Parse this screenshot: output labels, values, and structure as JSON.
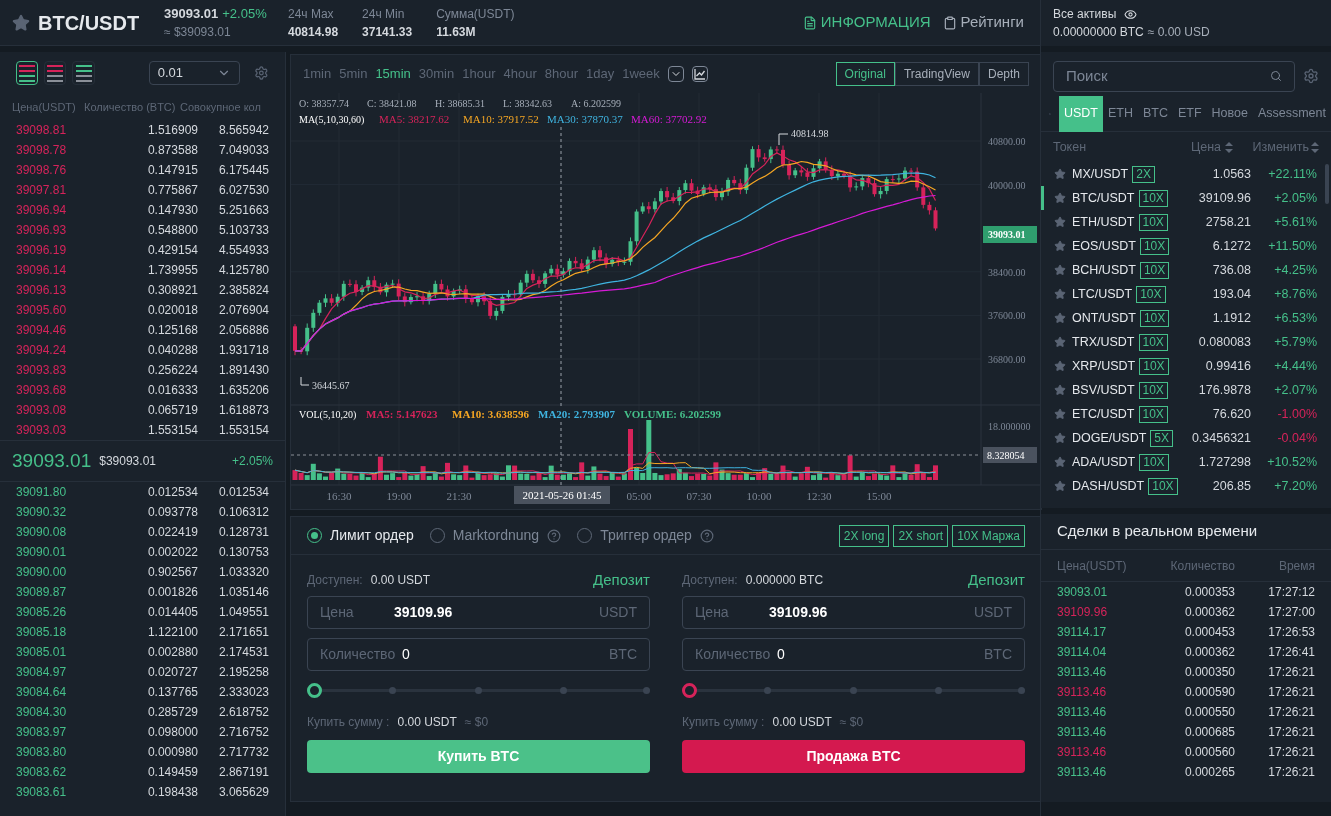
{
  "header": {
    "pair": "BTC/USDT",
    "price": "39093.01",
    "change": "+2.05%",
    "price_usd": "≈ $39093.01",
    "stats": [
      {
        "label": "24ч Max",
        "value": "40814.98"
      },
      {
        "label": "24ч Min",
        "value": "37141.33"
      },
      {
        "label": "Сумма(USDT)",
        "value": "11.63M"
      }
    ],
    "links": [
      {
        "kind": "info",
        "label": "ИНФОРМАЦИЯ"
      },
      {
        "kind": "ratings",
        "label": "Рейтинги"
      }
    ]
  },
  "order_book": {
    "views": [
      {
        "kind": "both",
        "selected": true
      },
      {
        "kind": "asks",
        "selected": false
      },
      {
        "kind": "bids",
        "selected": false
      }
    ],
    "precision": "0.01",
    "columns": [
      "Цена(USDT)",
      "Количество (BTC)",
      "Совокупное кол"
    ],
    "asks": [
      [
        "39098.81",
        "1.516909",
        "8.565942"
      ],
      [
        "39098.78",
        "0.873588",
        "7.049033"
      ],
      [
        "39098.76",
        "0.147915",
        "6.175445"
      ],
      [
        "39097.81",
        "0.775867",
        "6.027530"
      ],
      [
        "39096.94",
        "0.147930",
        "5.251663"
      ],
      [
        "39096.93",
        "0.548800",
        "5.103733"
      ],
      [
        "39096.19",
        "0.429154",
        "4.554933"
      ],
      [
        "39096.14",
        "1.739955",
        "4.125780"
      ],
      [
        "39096.13",
        "0.308921",
        "2.385824"
      ],
      [
        "39095.60",
        "0.020018",
        "2.076904"
      ],
      [
        "39094.46",
        "0.125168",
        "2.056886"
      ],
      [
        "39094.24",
        "0.040288",
        "1.931718"
      ],
      [
        "39093.83",
        "0.256224",
        "1.891430"
      ],
      [
        "39093.68",
        "0.016333",
        "1.635206"
      ],
      [
        "39093.08",
        "0.065719",
        "1.618873"
      ],
      [
        "39093.03",
        "1.553154",
        "1.553154"
      ]
    ],
    "last_price": "39093.01",
    "last_price_usd": "$39093.01",
    "last_change": "+2.05%",
    "bids": [
      [
        "39091.80",
        "0.012534",
        "0.012534"
      ],
      [
        "39090.32",
        "0.093778",
        "0.106312"
      ],
      [
        "39090.08",
        "0.022419",
        "0.128731"
      ],
      [
        "39090.01",
        "0.002022",
        "0.130753"
      ],
      [
        "39090.00",
        "0.902567",
        "1.033320"
      ],
      [
        "39089.87",
        "0.001826",
        "1.035146"
      ],
      [
        "39085.26",
        "0.014405",
        "1.049551"
      ],
      [
        "39085.18",
        "1.122100",
        "2.171651"
      ],
      [
        "39085.01",
        "0.002880",
        "2.174531"
      ],
      [
        "39084.97",
        "0.020727",
        "2.195258"
      ],
      [
        "39084.64",
        "0.137765",
        "2.333023"
      ],
      [
        "39084.30",
        "0.285729",
        "2.618752"
      ],
      [
        "39083.97",
        "0.098000",
        "2.716752"
      ],
      [
        "39083.80",
        "0.000980",
        "2.717732"
      ],
      [
        "39083.62",
        "0.149459",
        "2.867191"
      ],
      [
        "39083.61",
        "0.198438",
        "3.065629"
      ]
    ]
  },
  "chart": {
    "timeframes": [
      {
        "label": "1min",
        "selected": false
      },
      {
        "label": "5min",
        "selected": false
      },
      {
        "label": "15min",
        "selected": true
      },
      {
        "label": "30min",
        "selected": false
      },
      {
        "label": "1hour",
        "selected": false
      },
      {
        "label": "4hour",
        "selected": false
      },
      {
        "label": "8hour",
        "selected": false
      },
      {
        "label": "1day",
        "selected": false
      },
      {
        "label": "1week",
        "selected": false
      }
    ],
    "views": [
      {
        "label": "Original",
        "selected": true
      },
      {
        "label": "TradingView",
        "selected": false
      },
      {
        "label": "Depth",
        "selected": false
      }
    ],
    "ohlc": [
      "O: 38357.74",
      "C: 38421.08",
      "H: 38685.31",
      "L: 38342.63",
      "A: 6.202599"
    ],
    "ma_title": "MA(5,10,30,60)",
    "ma": [
      {
        "text": "MA5: 38217.62",
        "color": "#d6235a"
      },
      {
        "text": "MA10: 37917.52",
        "color": "#f5a623"
      },
      {
        "text": "MA30: 37870.37",
        "color": "#3fb4e0"
      },
      {
        "text": "MA60: 37702.92",
        "color": "#d61ad6"
      }
    ],
    "price_ticks": [
      "40800.00",
      "40000.00",
      "38400.00",
      "37600.00",
      "36800.00"
    ],
    "last_price_tag": "39093.01",
    "high_marker": "40814.98",
    "low_marker": "36445.67",
    "vol_title": "VOL(5,10,20)",
    "vol_ma": [
      {
        "text": "MA5: 5.147623",
        "color": "#d6235a"
      },
      {
        "text": "MA10: 3.638596",
        "color": "#f5a623"
      },
      {
        "text": "MA20: 2.793907",
        "color": "#3fb4e0"
      },
      {
        "text": "VOLUME: 6.202599",
        "color": "#45c08a"
      }
    ],
    "vol_tick": "18.000000",
    "vol_tag": "8.328054",
    "time_ticks": [
      "16:30",
      "19:00",
      "21:30",
      "05:00",
      "07:30",
      "10:00",
      "12:30",
      "15:00"
    ],
    "crosshair_time": "2021-05-26 01:45"
  },
  "order_form": {
    "types": [
      {
        "label": "Лимит ордер",
        "selected": true,
        "help": false
      },
      {
        "label": "Marktordnung",
        "selected": false,
        "help": true
      },
      {
        "label": "Триггер ордер",
        "selected": false,
        "help": true
      }
    ],
    "leverage": [
      "2X long",
      "2X short",
      "10X Маржа"
    ],
    "sides": [
      {
        "kind": "buy",
        "available_label": "Доступен:",
        "available": "0.00 USDT",
        "deposit": "Депозит",
        "price_label": "Цена",
        "price": "39109.96",
        "price_unit": "USDT",
        "amount_label": "Количество",
        "amount": "0",
        "amount_unit": "BTC",
        "level": 0,
        "total_label": "Купить сумму :",
        "total": "0.00 USDT",
        "total_usd": "≈ $0",
        "button": "Купить BTC"
      },
      {
        "kind": "sell",
        "available_label": "Доступен:",
        "available": "0.000000 BTC",
        "deposit": "Депозит",
        "price_label": "Цена",
        "price": "39109.96",
        "price_unit": "USDT",
        "amount_label": "Количество",
        "amount": "0",
        "amount_unit": "BTC",
        "level": 0,
        "total_label": "Купить сумму :",
        "total": "0.00 USDT",
        "total_usd": "≈ $0",
        "button": "Продажа BTC"
      }
    ]
  },
  "assets": {
    "title": "Все активы",
    "balance": "0.00000000 BTC",
    "balance_usd": "≈ 0.00 USD"
  },
  "markets": {
    "search_placeholder": "Поиск",
    "tabs": [
      {
        "label": "USDT",
        "selected": true
      },
      {
        "label": "ETH",
        "selected": false
      },
      {
        "label": "BTC",
        "selected": false
      },
      {
        "label": "ETF",
        "selected": false
      },
      {
        "label": "Новое",
        "selected": false
      },
      {
        "label": "Assessment",
        "selected": false
      }
    ],
    "columns": [
      "Токен",
      "Цена",
      "Изменить"
    ],
    "pairs": [
      {
        "name": "MX/USDT",
        "leverage": "2X",
        "price": "1.0563",
        "change": "+22.11%",
        "up": true,
        "selected": false
      },
      {
        "name": "BTC/USDT",
        "leverage": "10X",
        "price": "39109.96",
        "change": "+2.05%",
        "up": true,
        "selected": true
      },
      {
        "name": "ETH/USDT",
        "leverage": "10X",
        "price": "2758.21",
        "change": "+5.61%",
        "up": true,
        "selected": false
      },
      {
        "name": "EOS/USDT",
        "leverage": "10X",
        "price": "6.1272",
        "change": "+11.50%",
        "up": true,
        "selected": false
      },
      {
        "name": "BCH/USDT",
        "leverage": "10X",
        "price": "736.08",
        "change": "+4.25%",
        "up": true,
        "selected": false
      },
      {
        "name": "LTC/USDT",
        "leverage": "10X",
        "price": "193.04",
        "change": "+8.76%",
        "up": true,
        "selected": false
      },
      {
        "name": "ONT/USDT",
        "leverage": "10X",
        "price": "1.1912",
        "change": "+6.53%",
        "up": true,
        "selected": false
      },
      {
        "name": "TRX/USDT",
        "leverage": "10X",
        "price": "0.080083",
        "change": "+5.79%",
        "up": true,
        "selected": false
      },
      {
        "name": "XRP/USDT",
        "leverage": "10X",
        "price": "0.99416",
        "change": "+4.44%",
        "up": true,
        "selected": false
      },
      {
        "name": "BSV/USDT",
        "leverage": "10X",
        "price": "176.9878",
        "change": "+2.07%",
        "up": true,
        "selected": false
      },
      {
        "name": "ETC/USDT",
        "leverage": "10X",
        "price": "76.620",
        "change": "-1.00%",
        "up": false,
        "selected": false
      },
      {
        "name": "DOGE/USDT",
        "leverage": "5X",
        "price": "0.3456321",
        "change": "-0.04%",
        "up": false,
        "selected": false
      },
      {
        "name": "ADA/USDT",
        "leverage": "10X",
        "price": "1.727298",
        "change": "+10.52%",
        "up": true,
        "selected": false
      },
      {
        "name": "DASH/USDT",
        "leverage": "10X",
        "price": "206.85",
        "change": "+7.20%",
        "up": true,
        "selected": false
      }
    ]
  },
  "trades": {
    "title": "Сделки в реальном времени",
    "columns": [
      "Цена(USDT)",
      "Количество",
      "Время"
    ],
    "rows": [
      {
        "price": "39093.01",
        "qty": "0.000353",
        "time": "17:27:12",
        "color": "#45c08a"
      },
      {
        "price": "39109.96",
        "qty": "0.000362",
        "time": "17:27:00",
        "color": "#d6235a"
      },
      {
        "price": "39114.17",
        "qty": "0.000453",
        "time": "17:26:53",
        "color": "#45c08a"
      },
      {
        "price": "39114.04",
        "qty": "0.000362",
        "time": "17:26:41",
        "color": "#45c08a"
      },
      {
        "price": "39113.46",
        "qty": "0.000350",
        "time": "17:26:21",
        "color": "#45c08a"
      },
      {
        "price": "39113.46",
        "qty": "0.000590",
        "time": "17:26:21",
        "color": "#d6235a"
      },
      {
        "price": "39113.46",
        "qty": "0.000550",
        "time": "17:26:21",
        "color": "#45c08a"
      },
      {
        "price": "39113.46",
        "qty": "0.000685",
        "time": "17:26:21",
        "color": "#45c08a"
      },
      {
        "price": "39113.46",
        "qty": "0.000560",
        "time": "17:26:21",
        "color": "#d6235a"
      },
      {
        "price": "39113.46",
        "qty": "0.000265",
        "time": "17:26:21",
        "color": "#45c08a"
      }
    ]
  }
}
